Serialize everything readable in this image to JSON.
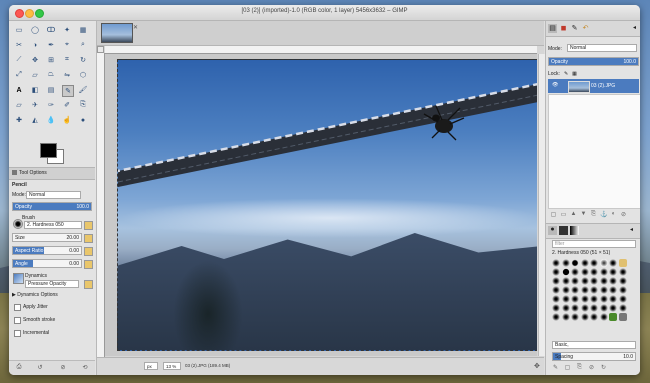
{
  "window": {
    "title": "[03 (2)] (imported)-1.0 (RGB color, 1 layer) 5456x3632 – GIMP"
  },
  "toolbox": {
    "tab_label": "Tool Options",
    "tool_name": "Pencil",
    "mode_label": "Mode:",
    "mode_value": "Normal",
    "opacity_label": "Opacity",
    "opacity_value": "100.0",
    "brush_label": "Brush",
    "brush_value": "2. Hardness 050",
    "size_label": "Size",
    "size_value": "20.00",
    "aspect_label": "Aspect Ratio",
    "aspect_value": "0.00",
    "angle_label": "Angle",
    "angle_value": "0.00",
    "dynamics_label": "Dynamics",
    "dynamics_value": "Pressure Opacity",
    "dynamics_options": "Dynamics Options",
    "apply_jitter": "Apply Jitter",
    "smooth_stroke": "Smooth stroke",
    "incremental": "Incremental"
  },
  "status": {
    "unit": "px",
    "zoom": "13 %",
    "info": "03 (2).JPG (189.4 MB)"
  },
  "layers": {
    "mode_label": "Mode:",
    "mode_value": "Normal",
    "opacity_label": "Opacity",
    "opacity_value": "100.0",
    "lock_label": "Lock:",
    "layer_name": "03 (2).JPG"
  },
  "brushes": {
    "filter_placeholder": "filter",
    "selected": "2. Hardness 050 (51 × 51)",
    "tag_label": "Basic,",
    "spacing_label": "Spacing",
    "spacing_value": "10.0"
  }
}
